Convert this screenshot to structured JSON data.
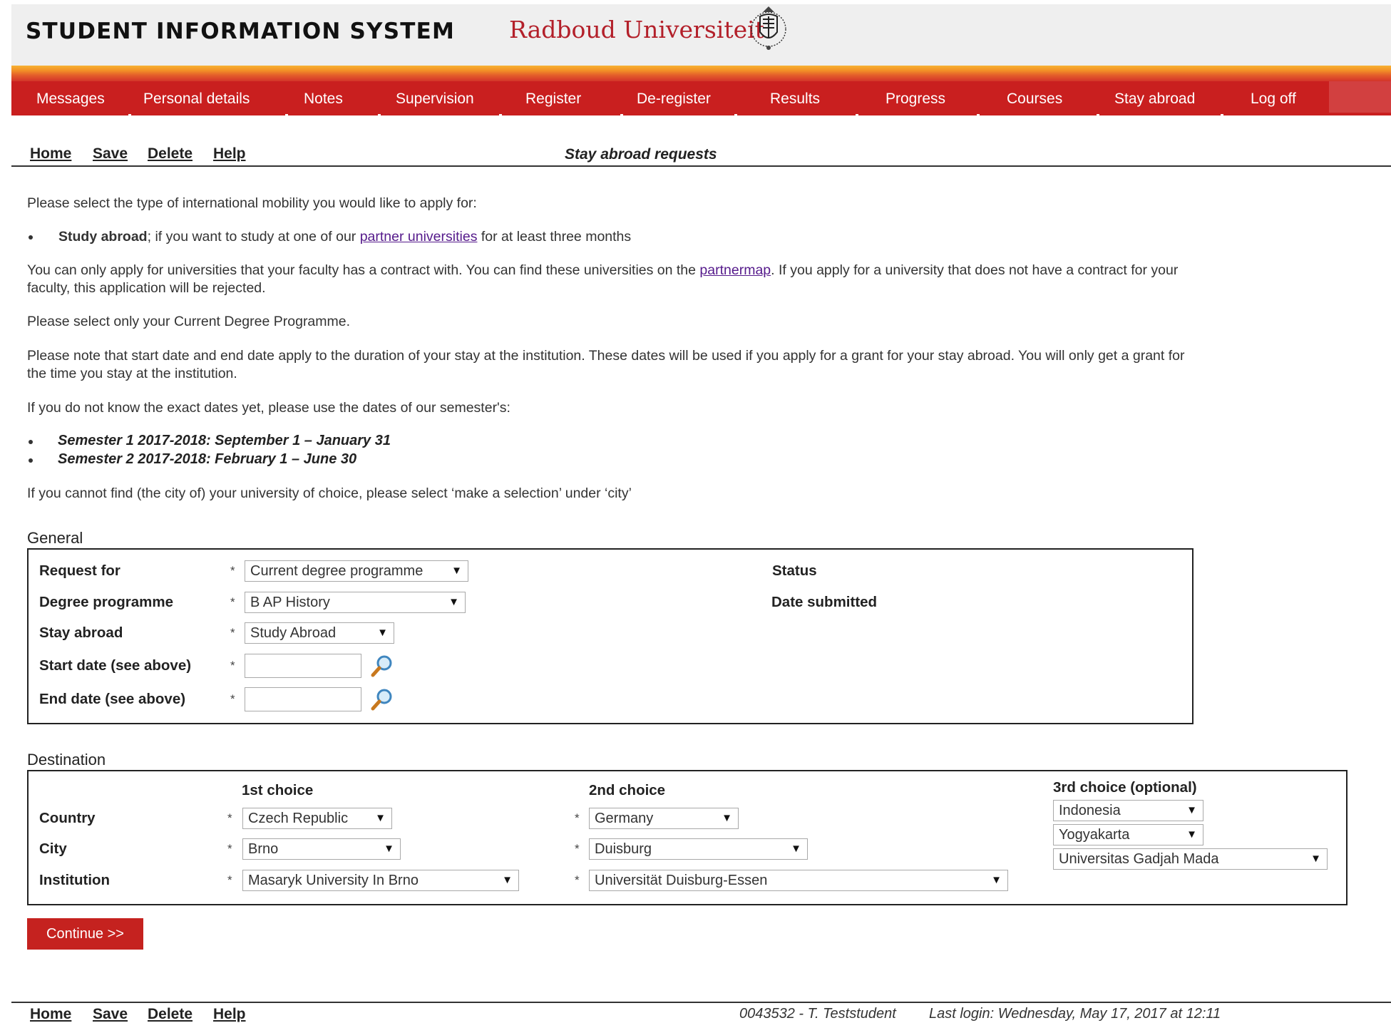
{
  "app": {
    "title": "STUDENT INFORMATION SYSTEM",
    "university": "Radboud Universiteit"
  },
  "nav": {
    "items": [
      "Messages",
      "Personal details",
      "Notes",
      "Supervision",
      "Register",
      "De-register",
      "Results",
      "Progress",
      "Courses",
      "Stay abroad",
      "Log off"
    ]
  },
  "toolbar": {
    "home": "Home",
    "save": "Save",
    "delete": "Delete",
    "help": "Help",
    "page_title": "Stay abroad requests"
  },
  "intro": {
    "p1": "Please select the type of international mobility you would like to apply for:",
    "bullet_bold": "Study abroad",
    "bullet_pre": "; if you want to study at one of our ",
    "bullet_link": "partner universities",
    "bullet_post": " for at least three months",
    "p2_pre": "You can only apply for universities that your faculty has a contract with. You can find these universities on the ",
    "p2_link": "partnermap",
    "p2_post": ". If you apply for a university that does not have a contract for your faculty, this application will be rejected.",
    "p3": "Please select only your Current Degree Programme.",
    "p4": "Please note that start date and end date apply to the duration of your stay at the institution. These dates will be used if you apply for a grant for your stay abroad. You will only get a grant for the time you stay at the institution.",
    "p5": "If you do not know the exact dates yet, please use the dates of our semester's:",
    "semester1": "Semester 1 2017-2018: September 1 – January 31",
    "semester2": "Semester 2 2017-2018: February 1 – June 30",
    "p6": "If you cannot find (the city of) your university of choice, please select ‘make a selection’ under ‘city’"
  },
  "general": {
    "title": "General",
    "request_for_label": "Request for",
    "request_for_value": "Current degree programme",
    "degree_label": "Degree programme",
    "degree_value": "B AP History",
    "stay_label": "Stay abroad",
    "stay_value": "Study Abroad",
    "start_label": "Start date (see above)",
    "end_label": "End date (see above)",
    "status_label": "Status",
    "date_submitted_label": "Date submitted",
    "required_mark": "*"
  },
  "destination": {
    "title": "Destination",
    "first_choice": "1st choice",
    "second_choice": "2nd choice",
    "third_choice": "3rd choice (optional)",
    "country_label": "Country",
    "city_label": "City",
    "institution_label": "Institution",
    "first": {
      "country": "Czech Republic",
      "city": "Brno",
      "institution": "Masaryk University In Brno"
    },
    "second": {
      "country": "Germany",
      "city": "Duisburg",
      "institution": "Universität Duisburg-Essen"
    },
    "third": {
      "country": "Indonesia",
      "city": "Yogyakarta",
      "institution": "Universitas Gadjah Mada"
    }
  },
  "actions": {
    "continue": "Continue >>"
  },
  "footer": {
    "student": "0043532 - T. Teststudent",
    "last_login": "Last login: Wednesday, May 17, 2017 at 12:11"
  },
  "colors": {
    "brand_red": "#c91f1f",
    "link": "#551a8b"
  },
  "icons": {
    "calendar_lookup": "magnifier-icon",
    "dropdown": "triangle-down-icon"
  }
}
